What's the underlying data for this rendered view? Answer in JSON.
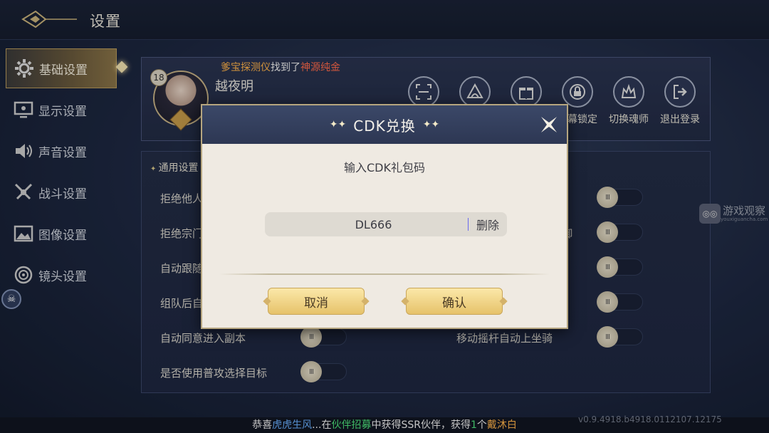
{
  "header": {
    "title": "设置"
  },
  "sidebar": {
    "items": [
      {
        "label": "基础设置",
        "icon": "gear-icon",
        "active": true
      },
      {
        "label": "显示设置",
        "icon": "monitor-icon",
        "active": false
      },
      {
        "label": "声音设置",
        "icon": "speaker-icon",
        "active": false
      },
      {
        "label": "战斗设置",
        "icon": "swords-icon",
        "active": false
      },
      {
        "label": "图像设置",
        "icon": "image-icon",
        "active": false
      },
      {
        "label": "镜头设置",
        "icon": "lens-icon",
        "active": false
      }
    ]
  },
  "profile": {
    "level": "18",
    "name": "越夜明",
    "notice": {
      "part1": "爹宝探测仪",
      "part2": "找到了",
      "part3": "神源纯金"
    },
    "buttons": [
      {
        "label": "",
        "icon": "scan-icon"
      },
      {
        "label": "",
        "icon": "hood-icon"
      },
      {
        "label": "",
        "icon": "gift-icon"
      },
      {
        "label": "屏幕锁定",
        "icon": "lock-icon"
      },
      {
        "label": "切换魂师",
        "icon": "crown-icon"
      },
      {
        "label": "退出登录",
        "icon": "logout-icon"
      }
    ]
  },
  "settings": {
    "section_title": "通用设置",
    "left_options": [
      "拒绝他人",
      "拒绝宗门",
      "自动跟随",
      "组队后自",
      "自动同意进入副本",
      "是否使用普攻选择目标"
    ],
    "right_options": [
      "",
      "",
      "",
      "",
      "移动摇杆自动上坐骑"
    ],
    "right_partial": "御"
  },
  "modal": {
    "title": "CDK兑换",
    "subtitle": "输入CDK礼包码",
    "input_value": "DL666",
    "delete_label": "删除",
    "cancel_label": "取消",
    "confirm_label": "确认"
  },
  "bottom_bar": {
    "p1": "恭喜",
    "name": "虎虎生风",
    "p2": "...在",
    "place": "伙伴招募",
    "p3": "中获得SSR伙伴，获得",
    "count": "1",
    "p4": "个",
    "item": "戴沐白"
  },
  "version": "v0.9.4918.b4918.0112107.12175",
  "watermark": {
    "text": "游戏观察",
    "sub": "youxiguancha.com"
  },
  "toggle_knob_glyph": "III"
}
